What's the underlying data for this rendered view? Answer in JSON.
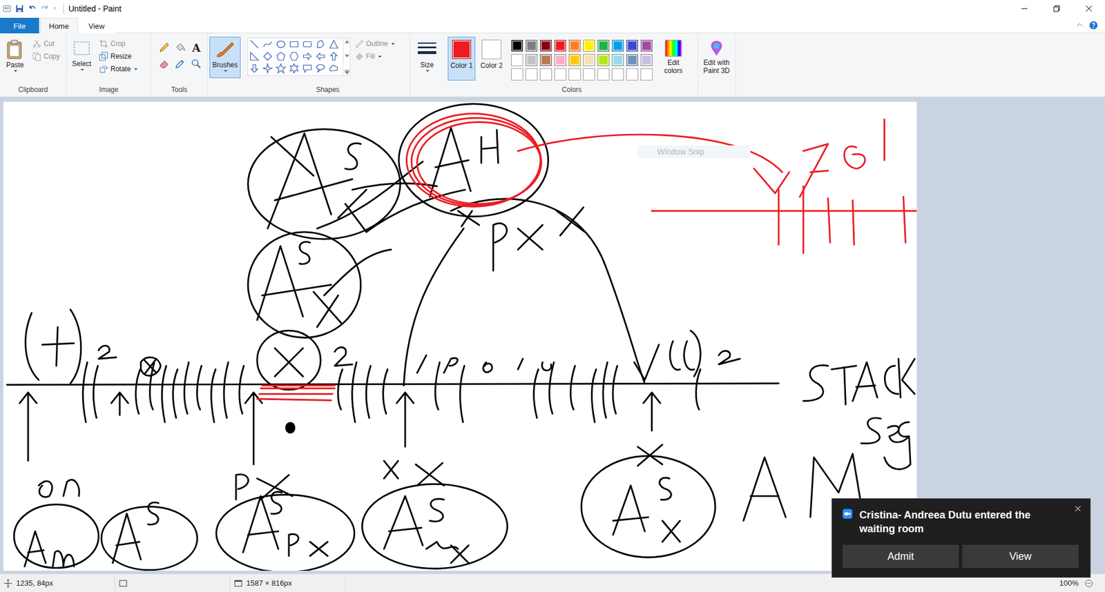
{
  "window": {
    "title": "Untitled - Paint"
  },
  "tabs": [
    {
      "label": "File",
      "selected": false,
      "kind": "file"
    },
    {
      "label": "Home",
      "selected": true,
      "kind": "tab"
    },
    {
      "label": "View",
      "selected": false,
      "kind": "tab"
    }
  ],
  "ribbon": {
    "clipboard": {
      "label": "Clipboard",
      "paste": "Paste",
      "cut": {
        "label": "Cut",
        "disabled": true
      },
      "copy": {
        "label": "Copy",
        "disabled": true
      }
    },
    "image": {
      "label": "Image",
      "select": "Select",
      "crop": {
        "label": "Crop",
        "disabled": true
      },
      "resize": {
        "label": "Resize",
        "disabled": false
      },
      "rotate": {
        "label": "Rotate",
        "disabled": false
      }
    },
    "tools": {
      "label": "Tools",
      "text_tool": "A"
    },
    "brushes": {
      "label": "Brushes",
      "selected": true
    },
    "shapes": {
      "label": "Shapes",
      "outline": {
        "label": "Outline",
        "disabled": true
      },
      "fill": {
        "label": "Fill",
        "disabled": true
      }
    },
    "size": {
      "label": "Size"
    },
    "colors": {
      "label": "Colors",
      "color1": {
        "label": "Color 1",
        "color": "#ed1c24",
        "selected": true
      },
      "color2": {
        "label": "Color 2",
        "color": "#ffffff",
        "selected": false
      },
      "palette": [
        {
          "color": "#000000"
        },
        {
          "color": "#7f7f7f"
        },
        {
          "color": "#880015"
        },
        {
          "color": "#ed1c24"
        },
        {
          "color": "#ff7f27"
        },
        {
          "color": "#fff200"
        },
        {
          "color": "#22b14c"
        },
        {
          "color": "#00a2e8"
        },
        {
          "color": "#3f48cc"
        },
        {
          "color": "#a349a4"
        },
        {
          "color": "#ffffff"
        },
        {
          "color": "#c3c3c3"
        },
        {
          "color": "#b97a57"
        },
        {
          "color": "#ffaec9"
        },
        {
          "color": "#ffc90e"
        },
        {
          "color": "#efe4b0"
        },
        {
          "color": "#b5e61d"
        },
        {
          "color": "#99d9ea"
        },
        {
          "color": "#7092be"
        },
        {
          "color": "#c8bfe7"
        },
        {
          "color": "#ffffff"
        },
        {
          "color": "#ffffff"
        },
        {
          "color": "#ffffff"
        },
        {
          "color": "#ffffff"
        },
        {
          "color": "#ffffff"
        },
        {
          "color": "#ffffff"
        },
        {
          "color": "#ffffff"
        },
        {
          "color": "#ffffff"
        },
        {
          "color": "#ffffff"
        },
        {
          "color": "#ffffff"
        }
      ],
      "edit": "Edit colors"
    },
    "paint3d": {
      "label": "Edit with Paint 3D"
    }
  },
  "canvas": {
    "watermark": "Window Snip"
  },
  "status_bar": {
    "cursor": "1235, 84px",
    "size": "1587 × 816px",
    "zoom": "100%"
  },
  "notification": {
    "message": "Cristina- Andreea Dutu entered the waiting room",
    "buttons": [
      "Admit",
      "View"
    ]
  }
}
